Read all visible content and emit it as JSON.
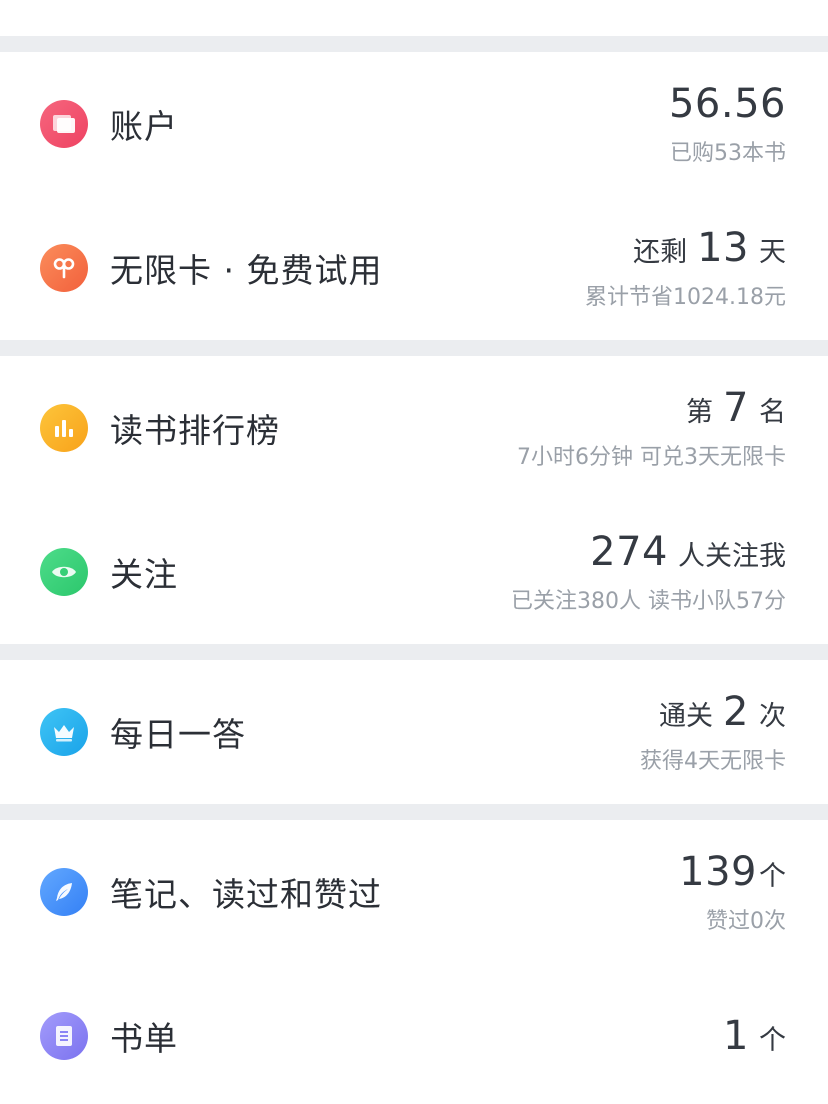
{
  "colors": {
    "account": "#f04f6b",
    "unlimited": "#f6764b",
    "ranking": "#fbb328",
    "follow": "#38d27a",
    "daily": "#27b6f0",
    "notes": "#4a94fb",
    "booklist": "#8b84f5",
    "divider": "#ebedf0"
  },
  "account": {
    "icon": "wallet-icon",
    "label": "账户",
    "value": "56.56",
    "sub": "已购53本书"
  },
  "unlimited": {
    "icon": "infinity-card-icon",
    "label": "无限卡 · 免费试用",
    "prefix": "还剩",
    "value": "13",
    "suffix": "天",
    "sub": "累计节省1024.18元"
  },
  "ranking": {
    "icon": "bar-chart-icon",
    "label": "读书排行榜",
    "prefix": "第",
    "value": "7",
    "suffix": "名",
    "sub": "7小时6分钟 可兑3天无限卡"
  },
  "follow": {
    "icon": "eye-icon",
    "label": "关注",
    "value": "274",
    "suffix": "人关注我",
    "sub": "已关注380人 读书小队57分"
  },
  "daily": {
    "icon": "crown-icon",
    "label": "每日一答",
    "prefix": "通关",
    "value": "2",
    "suffix": "次",
    "sub": "获得4天无限卡"
  },
  "notes": {
    "icon": "feather-icon",
    "label": "笔记、读过和赞过",
    "value": "139",
    "suffix": "个",
    "sub": "赞过0次"
  },
  "booklist": {
    "icon": "list-document-icon",
    "label": "书单",
    "value": "1",
    "suffix": "个"
  }
}
